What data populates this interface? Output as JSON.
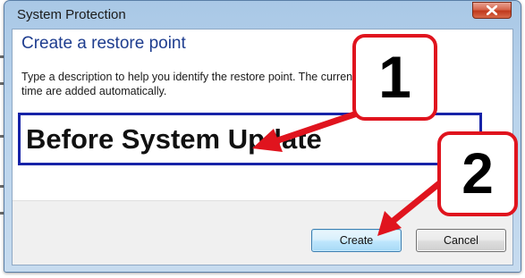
{
  "window": {
    "title": "System Protection",
    "close_label": "×"
  },
  "content": {
    "heading": "Create a restore point",
    "description_line1": "Type a description to help you identify the restore point. The current date and",
    "description_line2": "time are added automatically.",
    "restore_point_name": "Before System Update"
  },
  "buttons": {
    "create": "Create",
    "cancel": "Cancel"
  },
  "annotations": {
    "callout_1": "1",
    "callout_2": "2",
    "accent_color": "#e0141e"
  },
  "colors": {
    "heading": "#1e3d8f",
    "input_border": "#1723a8",
    "title_bar": "#b9d3ec",
    "close_button": "#c7432b"
  }
}
